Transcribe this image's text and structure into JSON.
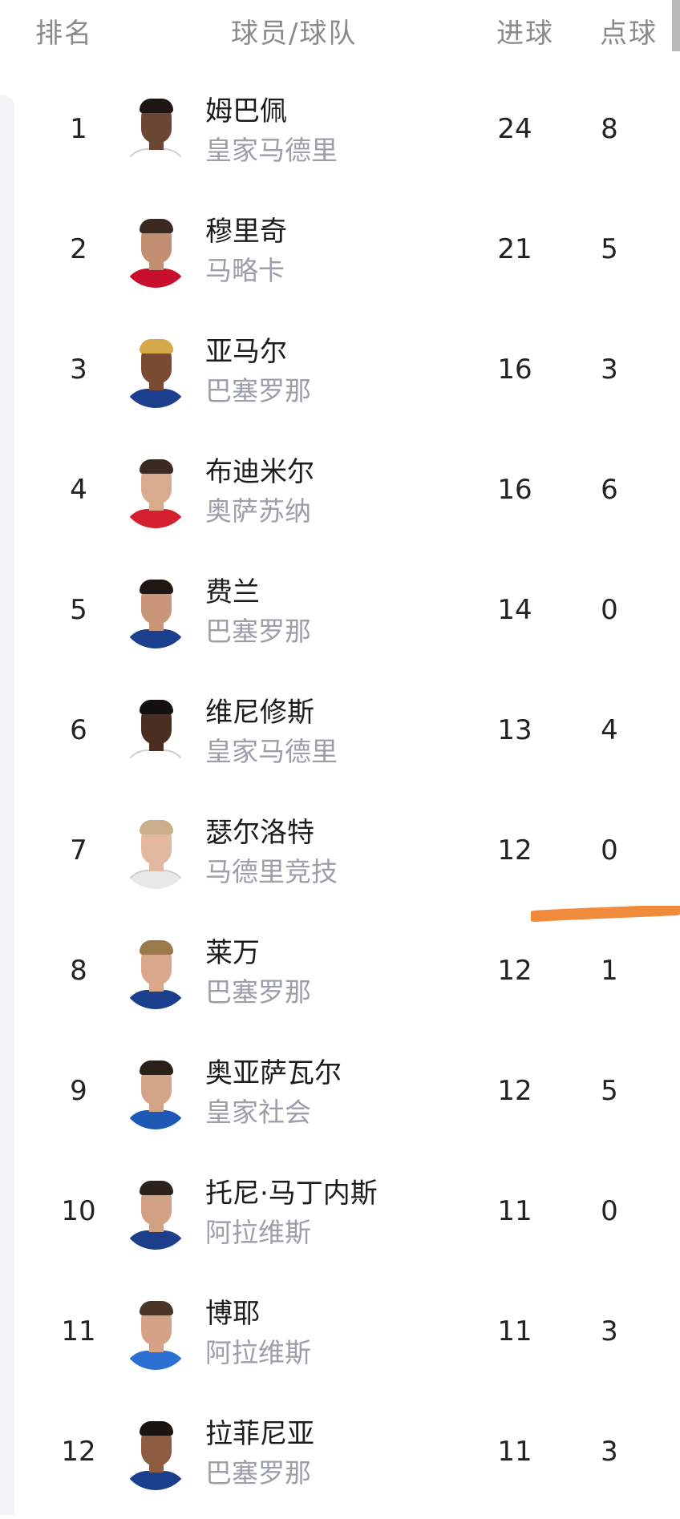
{
  "header": {
    "rank": "排名",
    "player_team": "球员/球队",
    "goals": "进球",
    "penalties": "点球"
  },
  "players": [
    {
      "rank": "1",
      "name": "姆巴佩",
      "team": "皇家马德里",
      "goals": "24",
      "penalties": "8",
      "shirt": "#ffffff",
      "skin": "#6b4634",
      "hair": "#1e1613"
    },
    {
      "rank": "2",
      "name": "穆里奇",
      "team": "马略卡",
      "goals": "21",
      "penalties": "5",
      "shirt": "#c8102e",
      "skin": "#c28e72",
      "hair": "#3a2a22"
    },
    {
      "rank": "3",
      "name": "亚马尔",
      "team": "巴塞罗那",
      "goals": "16",
      "penalties": "3",
      "shirt": "#1b3f8c",
      "skin": "#7a4a33",
      "hair": "#d6a84a"
    },
    {
      "rank": "4",
      "name": "布迪米尔",
      "team": "奥萨苏纳",
      "goals": "16",
      "penalties": "6",
      "shirt": "#d3202f",
      "skin": "#d9ab8e",
      "hair": "#3b2a20"
    },
    {
      "rank": "5",
      "name": "费兰",
      "team": "巴塞罗那",
      "goals": "14",
      "penalties": "0",
      "shirt": "#1b3f8c",
      "skin": "#c9967a",
      "hair": "#1f1714"
    },
    {
      "rank": "6",
      "name": "维尼修斯",
      "team": "皇家马德里",
      "goals": "13",
      "penalties": "4",
      "shirt": "#ffffff",
      "skin": "#4a2e22",
      "hair": "#141010"
    },
    {
      "rank": "7",
      "name": "瑟尔洛特",
      "team": "马德里竞技",
      "goals": "12",
      "penalties": "0",
      "shirt": "#e8e8e8",
      "skin": "#e2b9a0",
      "hair": "#c9b08a"
    },
    {
      "rank": "8",
      "name": "莱万",
      "team": "巴塞罗那",
      "goals": "12",
      "penalties": "1",
      "shirt": "#1b3f8c",
      "skin": "#d9a88a",
      "hair": "#9a7a4a"
    },
    {
      "rank": "9",
      "name": "奥亚萨瓦尔",
      "team": "皇家社会",
      "goals": "12",
      "penalties": "5",
      "shirt": "#1e58b5",
      "skin": "#d4a488",
      "hair": "#2a201a"
    },
    {
      "rank": "10",
      "name": "托尼·马丁内斯",
      "team": "阿拉维斯",
      "goals": "11",
      "penalties": "0",
      "shirt": "#1d3f8a",
      "skin": "#d2a083",
      "hair": "#2c211b"
    },
    {
      "rank": "11",
      "name": "博耶",
      "team": "阿拉维斯",
      "goals": "11",
      "penalties": "3",
      "shirt": "#2a6fd1",
      "skin": "#d4a387",
      "hair": "#4a3526"
    },
    {
      "rank": "12",
      "name": "拉菲尼亚",
      "team": "巴塞罗那",
      "goals": "11",
      "penalties": "3",
      "shirt": "#1b3f8c",
      "skin": "#8e5c40",
      "hair": "#1a1411"
    }
  ],
  "highlight_color": "#f08a3c"
}
